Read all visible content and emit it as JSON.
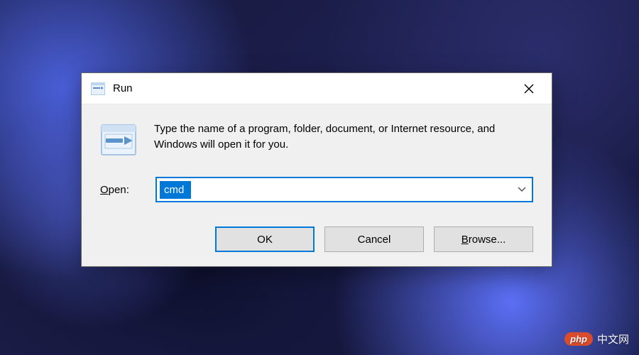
{
  "dialog": {
    "title": "Run",
    "description": "Type the name of a program, folder, document, or Internet resource, and Windows will open it for you.",
    "open_label_pre": "",
    "open_label_u": "O",
    "open_label_post": "pen:",
    "input_value": "cmd",
    "buttons": {
      "ok": "OK",
      "cancel": "Cancel",
      "browse_u": "B",
      "browse_post": "rowse..."
    }
  },
  "watermark": {
    "badge": "php",
    "text": "中文网"
  }
}
